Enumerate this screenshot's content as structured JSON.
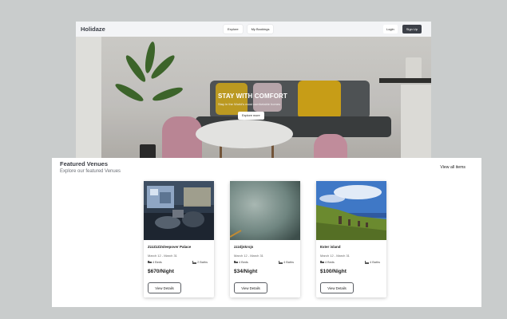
{
  "nav": {
    "brand": "Holidaze",
    "explore": "Explore",
    "bookings": "My Bookings",
    "login": "Login",
    "signup": "Sign Up"
  },
  "hero": {
    "title": "STAY WITH COMFORT",
    "subtitle": "Stay in the World's most comfortable homes",
    "button": "Explore more"
  },
  "featured": {
    "title": "Featured Venues",
    "subtitle": "Explore our featured Venues",
    "view_all": "View all items"
  },
  "venues": [
    {
      "name": "ZzzZzZZsleepover Palace",
      "dates": "March 12 - March 31",
      "beds": "4 Beds",
      "baths": "2 Baths",
      "price": "$670/Night",
      "button": "View Details"
    },
    {
      "name": "zzzdjnkrojs",
      "dates": "March 12 - March 31",
      "beds": "4 Beds",
      "baths": "4 Baths",
      "price": "$34/Night",
      "button": "View Details"
    },
    {
      "name": "Exter island",
      "dates": "March 12 - March 31",
      "beds": "4 Beds",
      "baths": "4 Baths",
      "price": "$100/Night",
      "button": "View Details"
    }
  ]
}
